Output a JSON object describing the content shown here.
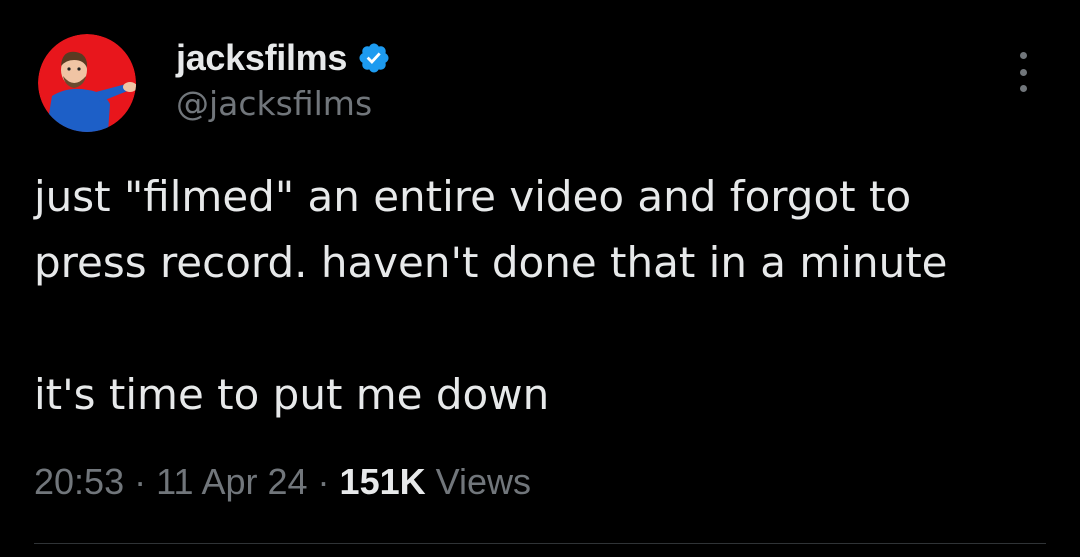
{
  "author": {
    "display_name": "jacksfilms",
    "handle": "@jacksfilms",
    "verified": true
  },
  "tweet": {
    "lines": [
      "just \"filmed\" an entire video and forgot to",
      "press record. haven't done that in a minute",
      "",
      "it's time to put me down"
    ],
    "time": "20:53",
    "separator1": " · ",
    "date": "11 Apr 24",
    "separator2": " · ",
    "views_count": "151K",
    "views_label": " Views"
  },
  "icons": {
    "verified": "verified-badge-icon",
    "more": "more-options-icon"
  },
  "colors": {
    "background": "#000000",
    "primary_text": "#e7e9ea",
    "secondary_text": "#71767b",
    "verified_blue": "#1d9bf0",
    "avatar_red": "#e8161c"
  }
}
